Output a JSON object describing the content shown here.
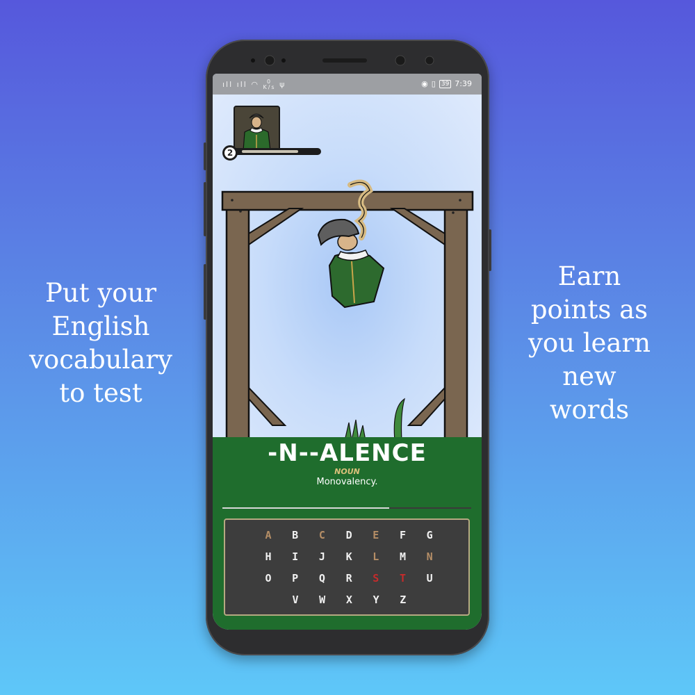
{
  "promo": {
    "left_lines": [
      "Put your",
      "English",
      "vocabulary",
      "to test"
    ],
    "right_lines": [
      "Earn",
      "points as",
      "you learn",
      "new",
      "words"
    ]
  },
  "status_bar": {
    "network_speed": "0",
    "network_unit": "K/s",
    "battery": "39",
    "time": "7:39"
  },
  "player": {
    "level": "2",
    "xp_progress": 0.75
  },
  "puzzle": {
    "masked_word": "-N--ALENCE",
    "part_of_speech": "NOUN",
    "definition": "Monovalency.",
    "progress": 0.67
  },
  "keyboard": {
    "rows": [
      [
        {
          "letter": "A",
          "state": "correct"
        },
        {
          "letter": "B",
          "state": "available"
        },
        {
          "letter": "C",
          "state": "correct"
        },
        {
          "letter": "D",
          "state": "available"
        },
        {
          "letter": "E",
          "state": "correct"
        },
        {
          "letter": "F",
          "state": "available"
        },
        {
          "letter": "G",
          "state": "available"
        }
      ],
      [
        {
          "letter": "H",
          "state": "available"
        },
        {
          "letter": "I",
          "state": "available"
        },
        {
          "letter": "J",
          "state": "available"
        },
        {
          "letter": "K",
          "state": "available"
        },
        {
          "letter": "L",
          "state": "correct"
        },
        {
          "letter": "M",
          "state": "available"
        },
        {
          "letter": "N",
          "state": "correct"
        }
      ],
      [
        {
          "letter": "O",
          "state": "available"
        },
        {
          "letter": "P",
          "state": "available"
        },
        {
          "letter": "Q",
          "state": "available"
        },
        {
          "letter": "R",
          "state": "available"
        },
        {
          "letter": "S",
          "state": "wrong"
        },
        {
          "letter": "T",
          "state": "wrong"
        },
        {
          "letter": "U",
          "state": "available"
        }
      ],
      [
        {
          "letter": "V",
          "state": "available"
        },
        {
          "letter": "W",
          "state": "available"
        },
        {
          "letter": "X",
          "state": "available"
        },
        {
          "letter": "Y",
          "state": "available"
        },
        {
          "letter": "Z",
          "state": "available"
        }
      ]
    ]
  },
  "colors": {
    "key_available": "#f1f1f1",
    "key_correct": "#b58e66",
    "key_wrong": "#c62b2b",
    "ground": "#1f6d2d",
    "keyboard_border": "#b6a982"
  },
  "icons": [
    "avatar-portrait",
    "signal-icon",
    "wifi-icon",
    "usb-icon",
    "eye-icon",
    "vibrate-icon",
    "battery-icon"
  ]
}
